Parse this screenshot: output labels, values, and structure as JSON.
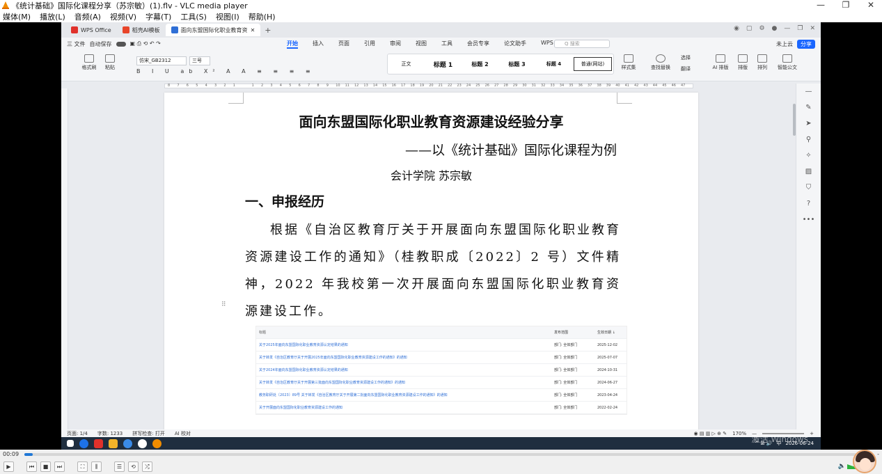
{
  "vlc": {
    "window_title": "《统计基础》国际化课程分享（苏宗敏）(1).flv - VLC media player",
    "menu": [
      "媒体(M)",
      "播放(L)",
      "音频(A)",
      "视频(V)",
      "字幕(T)",
      "工具(S)",
      "视图(I)",
      "帮助(H)"
    ],
    "time_elapsed": "00:09",
    "time_total": "-",
    "progress_fraction": 0.01,
    "volume_label": "15"
  },
  "wps": {
    "tabs": [
      {
        "label": "WPS Office",
        "color": "#e0312b"
      },
      {
        "label": "稻壳AI模板",
        "color": "#e8452a"
      },
      {
        "label": "面向东盟国际化职业教育资",
        "color": "#2f6fd6"
      }
    ],
    "file_menu": "三 文件",
    "autosave_label": "自动保存",
    "ribbon_tabs": [
      "开始",
      "插入",
      "页面",
      "引用",
      "审阅",
      "视图",
      "工具",
      "会员专享",
      "论文助手",
      "WPS AI"
    ],
    "active_tab": "开始",
    "search_placeholder": "Q 搜索",
    "cloud_status": "未上云",
    "share_label": "分享",
    "clipboard": {
      "format_painter": "格式刷",
      "paste": "粘贴"
    },
    "font_name": "仿宋_GB2312",
    "font_size": "三号",
    "styles": [
      "正文",
      "标题 1",
      "标题 2",
      "标题 3",
      "标题 4",
      "普通(网站)"
    ],
    "ribbon_right": [
      "样式集",
      "查找替换",
      "选择",
      "翻译",
      "AI 排版",
      "排版",
      "排列",
      "智能公文"
    ],
    "ruler_numbers": [
      "8",
      "7",
      "6",
      "5",
      "4",
      "3",
      "2",
      "1",
      "",
      "1",
      "2",
      "3",
      "4",
      "5",
      "6",
      "7",
      "8",
      "9",
      "10",
      "11",
      "12",
      "13",
      "14",
      "15",
      "16",
      "17",
      "18",
      "19",
      "20",
      "21",
      "22",
      "23",
      "24",
      "25",
      "26",
      "27",
      "28",
      "29",
      "30",
      "31",
      "32",
      "33",
      "34",
      "35",
      "36",
      "37",
      "38",
      "39",
      "40",
      "41",
      "42",
      "43",
      "44",
      "45",
      "46",
      "47"
    ],
    "status": {
      "page": "页面: 1/4",
      "words": "字数: 1233",
      "spell": "拼写检查: 打开",
      "ai": "AI 校对",
      "zoom": "170%"
    }
  },
  "document": {
    "title": "面向东盟国际化职业教育资源建设经验分享",
    "subtitle": "——以《统计基础》国际化课程为例",
    "author": "会计学院    苏宗敏",
    "heading1": "一、申报经历",
    "paragraph": "根据《自治区教育厅关于开展面向东盟国际化职业教育资源建设工作的通知》（桂教职成〔2022〕2 号）文件精神，2022 年我校第一次开展面向东盟国际化职业教育资源建设工作。",
    "cut_line": "…",
    "table": {
      "headers": [
        "标题",
        "发布范围",
        "生效日期 ↓"
      ],
      "rows": [
        [
          "关于2025年面向东盟国际化职业教育资源认定结果的通知",
          "部门: 全体部门",
          "2025-12-02"
        ],
        [
          "关于转发《自治区教育厅关于开展2025年面向东盟国际化职业教育资源建设工作的通知》的通知",
          "部门: 全体部门",
          "2025-07-07"
        ],
        [
          "关于2024年面向东盟国际化职业教育资源认定结果的通知",
          "部门: 全体部门",
          "2024-10-31"
        ],
        [
          "关于转发《自治区教育厅关于开展第三批面向东盟国际化职业教育资源建设工作的通知》的通知",
          "部门: 全体部门",
          "2024-06-27"
        ],
        [
          "教务职研处〔2023〕89号 关于转发《自治区教育厅关于开展第二批面向东盟国际化职业教育资源建设工作的通知》的通知",
          "部门: 全体部门",
          "2023-04-24"
        ],
        [
          "关于开展面向东盟国际化职业教育资源建设工作的通知",
          "部门: 全体部门",
          "2022-02-24"
        ]
      ]
    }
  },
  "taskbar": {
    "ime": "中",
    "time": "",
    "date": "2026-06-24",
    "activation": "激活 Windows"
  }
}
